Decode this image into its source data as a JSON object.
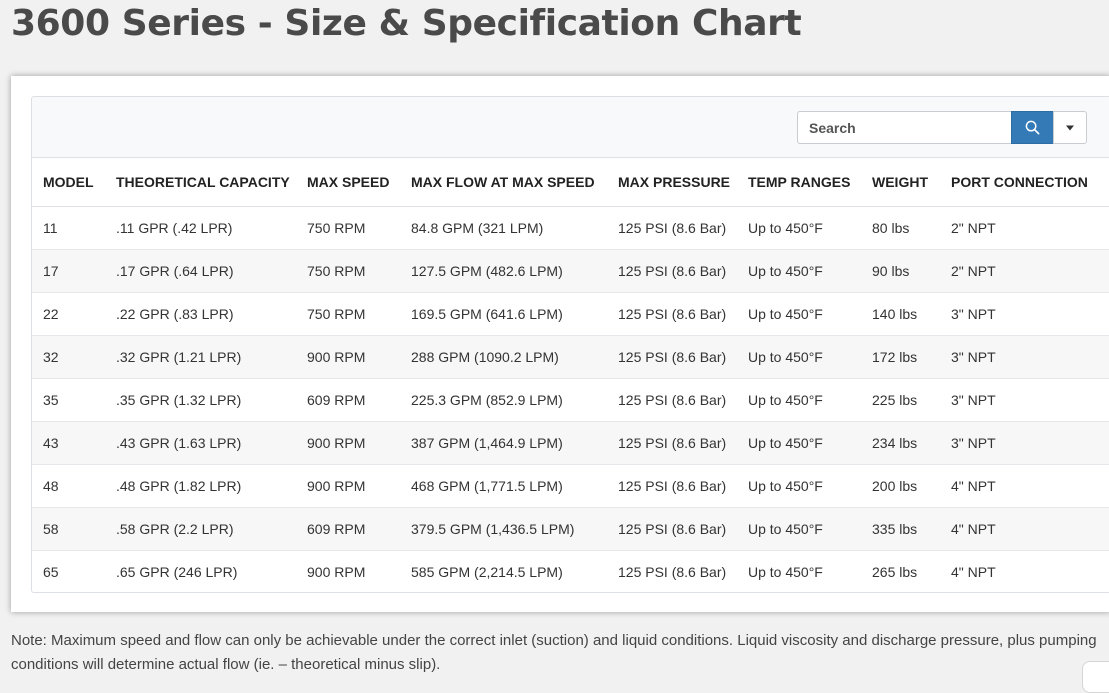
{
  "page": {
    "title": "3600 Series - Size & Specification Chart",
    "note": "Note: Maximum speed and flow can only be achievable under the correct inlet (suction) and liquid conditions. Liquid viscosity and discharge pressure, plus pumping conditions will determine actual flow (ie. – theoretical minus slip)."
  },
  "toolbar": {
    "search_placeholder": "Search",
    "search_icon": "search-icon",
    "dropdown_icon": "caret-down-icon",
    "accent_color": "#337ab7"
  },
  "table": {
    "columns": [
      "MODEL",
      "THEORETICAL CAPACITY",
      "MAX SPEED",
      "MAX FLOW AT MAX SPEED",
      "MAX PRESSURE",
      "TEMP RANGES",
      "WEIGHT",
      "PORT CONNECTION"
    ],
    "rows": [
      [
        "11",
        ".11 GPR (.42 LPR)",
        "750 RPM",
        "84.8 GPM (321 LPM)",
        "125 PSI (8.6 Bar)",
        "Up to 450°F",
        "80 lbs",
        "2\" NPT"
      ],
      [
        "17",
        ".17 GPR (.64 LPR)",
        "750 RPM",
        "127.5 GPM (482.6 LPM)",
        "125 PSI (8.6 Bar)",
        "Up to 450°F",
        "90 lbs",
        "2\" NPT"
      ],
      [
        "22",
        ".22 GPR (.83 LPR)",
        "750 RPM",
        "169.5 GPM (641.6 LPM)",
        "125 PSI (8.6 Bar)",
        "Up to 450°F",
        "140 lbs",
        "3\" NPT"
      ],
      [
        "32",
        ".32 GPR (1.21 LPR)",
        "900 RPM",
        "288 GPM (1090.2 LPM)",
        "125 PSI (8.6 Bar)",
        "Up to 450°F",
        "172 lbs",
        "3\" NPT"
      ],
      [
        "35",
        ".35 GPR (1.32 LPR)",
        "609 RPM",
        "225.3 GPM (852.9 LPM)",
        "125 PSI (8.6 Bar)",
        "Up to 450°F",
        "225 lbs",
        "3\" NPT"
      ],
      [
        "43",
        ".43 GPR (1.63 LPR)",
        "900 RPM",
        "387 GPM (1,464.9 LPM)",
        "125 PSI (8.6 Bar)",
        "Up to 450°F",
        "234 lbs",
        "3\" NPT"
      ],
      [
        "48",
        ".48 GPR (1.82 LPR)",
        "900 RPM",
        "468 GPM (1,771.5 LPM)",
        "125 PSI (8.6 Bar)",
        "Up to 450°F",
        "200 lbs",
        "4\" NPT"
      ],
      [
        "58",
        ".58 GPR (2.2 LPR)",
        "609 RPM",
        "379.5 GPM (1,436.5 LPM)",
        "125 PSI (8.6 Bar)",
        "Up to 450°F",
        "335 lbs",
        "4\" NPT"
      ],
      [
        "65",
        ".65 GPR (246 LPR)",
        "900 RPM",
        "585 GPM (2,214.5 LPM)",
        "125 PSI (8.6 Bar)",
        "Up to 450°F",
        "265 lbs",
        "4\" NPT"
      ]
    ]
  }
}
